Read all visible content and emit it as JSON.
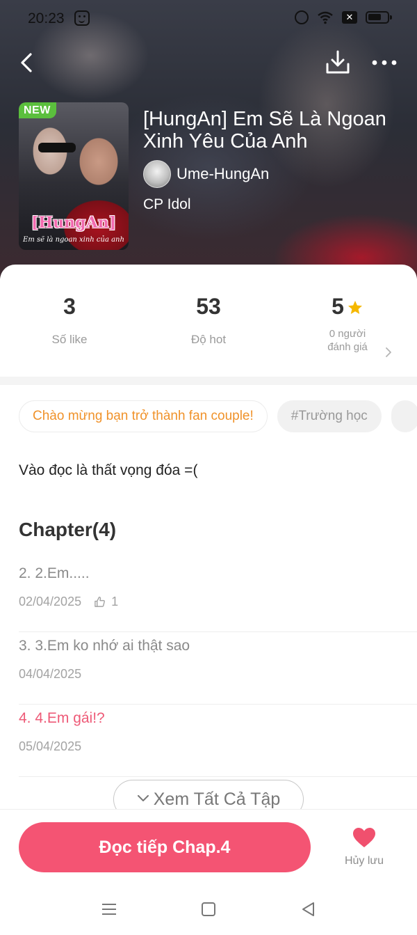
{
  "status_bar": {
    "time": "20:23",
    "x_badge": "✕"
  },
  "story": {
    "badge": "NEW",
    "cover_title": "[HungAn]",
    "cover_subtitle": "Em sẽ là ngoan xinh của anh",
    "title": "[HungAn] Em Sẽ Là Ngoan Xinh Yêu Của Anh",
    "author": "Ume-HungAn",
    "category": "CP Idol"
  },
  "stats": {
    "likes": {
      "value": "3",
      "label": "Số like"
    },
    "hot": {
      "value": "53",
      "label": "Độ hot"
    },
    "rating": {
      "value": "5",
      "label_line1": "0 người",
      "label_line2": "đánh giá"
    }
  },
  "tags": [
    "Chào mừng bạn trở thành fan couple!",
    "#Trường học"
  ],
  "summary": "Vào đọc là thất vọng đóa =(",
  "chapters": {
    "heading": "Chapter(4)",
    "items": [
      {
        "title": "2. 2.Em.....",
        "date": "02/04/2025",
        "likes": "1"
      },
      {
        "title": "3. 3.Em ko nhớ ai thật sao",
        "date": "04/04/2025"
      },
      {
        "title": "4. 4.Em gái!?",
        "date": "05/04/2025"
      }
    ],
    "view_all": "Xem Tất Cả Tập"
  },
  "actions": {
    "continue_reading": "Đọc tiếp Chap.4",
    "unsave": "Hủy lưu"
  },
  "colors": {
    "accent": "#f45473",
    "current_chapter": "#ee5a77",
    "new_badge": "#5bbf3d",
    "fan_tag_text": "#f0922a",
    "star": "#f5b800"
  },
  "icons": [
    "back-icon",
    "download-icon",
    "more-icon",
    "star-icon",
    "chevron-right-icon",
    "thumb-up-icon",
    "chevron-down-icon",
    "heart-icon",
    "menu-icon",
    "home-icon",
    "back-triangle-icon"
  ]
}
